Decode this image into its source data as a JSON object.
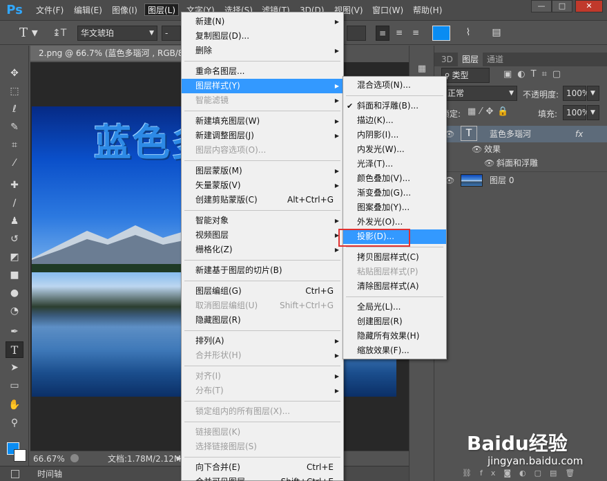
{
  "app": {
    "logo": "Ps"
  },
  "menubar": {
    "items": [
      "文件(F)",
      "编辑(E)",
      "图像(I)",
      "图层(L)",
      "文字(Y)",
      "选择(S)",
      "滤镜(T)",
      "3D(D)",
      "视图(V)",
      "窗口(W)",
      "帮助(H)"
    ]
  },
  "window_controls": {
    "minimize": "—",
    "maximize": "□",
    "close": "✕"
  },
  "options": {
    "font_family": "华文琥珀",
    "font_style": "-",
    "color": "#0a8cf2"
  },
  "document": {
    "tab_title": "2.png @ 66.7% (蓝色多瑙河 , RGB/8) *",
    "title_text": "蓝色多",
    "zoom": "66.67%",
    "doc_info": "文档:1.78M/2.12M",
    "timeline_tab": "时间轴"
  },
  "layers_panel": {
    "tabs": [
      "3D",
      "图层",
      "通道"
    ],
    "filter_kind": "类型",
    "blend_mode": "正常",
    "opacity_label": "不透明度:",
    "opacity_value": "100%",
    "lock_label": "锁定:",
    "fill_label": "填充:",
    "fill_value": "100%",
    "layers": [
      {
        "name": "蓝色多瑙河",
        "type": "text",
        "fx": "fx"
      },
      {
        "name": "效果"
      },
      {
        "name": "斜面和浮雕"
      },
      {
        "name": "图层 0",
        "type": "image"
      }
    ]
  },
  "layer_menu": {
    "items": [
      {
        "label": "新建(N)",
        "submenu": true
      },
      {
        "label": "复制图层(D)..."
      },
      {
        "label": "删除",
        "submenu": true
      },
      {
        "sep": true
      },
      {
        "label": "重命名图层..."
      },
      {
        "label": "图层样式(Y)",
        "submenu": true,
        "highlighted": true
      },
      {
        "label": "智能滤镜",
        "submenu": true,
        "disabled": true
      },
      {
        "sep": true
      },
      {
        "label": "新建填充图层(W)",
        "submenu": true
      },
      {
        "label": "新建调整图层(J)",
        "submenu": true
      },
      {
        "label": "图层内容选项(O)...",
        "disabled": true
      },
      {
        "sep": true
      },
      {
        "label": "图层蒙版(M)",
        "submenu": true
      },
      {
        "label": "矢量蒙版(V)",
        "submenu": true
      },
      {
        "label": "创建剪贴蒙版(C)",
        "shortcut": "Alt+Ctrl+G"
      },
      {
        "sep": true
      },
      {
        "label": "智能对象",
        "submenu": true
      },
      {
        "label": "视频图层",
        "submenu": true
      },
      {
        "label": "栅格化(Z)",
        "submenu": true
      },
      {
        "sep": true
      },
      {
        "label": "新建基于图层的切片(B)"
      },
      {
        "sep": true
      },
      {
        "label": "图层编组(G)",
        "shortcut": "Ctrl+G"
      },
      {
        "label": "取消图层编组(U)",
        "shortcut": "Shift+Ctrl+G",
        "disabled": true
      },
      {
        "label": "隐藏图层(R)"
      },
      {
        "sep": true
      },
      {
        "label": "排列(A)",
        "submenu": true
      },
      {
        "label": "合并形状(H)",
        "submenu": true,
        "disabled": true
      },
      {
        "sep": true
      },
      {
        "label": "对齐(I)",
        "submenu": true,
        "disabled": true
      },
      {
        "label": "分布(T)",
        "submenu": true,
        "disabled": true
      },
      {
        "sep": true
      },
      {
        "label": "锁定组内的所有图层(X)...",
        "disabled": true
      },
      {
        "sep": true
      },
      {
        "label": "链接图层(K)",
        "disabled": true
      },
      {
        "label": "选择链接图层(S)",
        "disabled": true
      },
      {
        "sep": true
      },
      {
        "label": "向下合并(E)",
        "shortcut": "Ctrl+E"
      },
      {
        "label": "合并可见图层",
        "shortcut": "Shift+Ctrl+E"
      }
    ]
  },
  "style_submenu": {
    "items": [
      {
        "label": "混合选项(N)..."
      },
      {
        "sep": true
      },
      {
        "label": "斜面和浮雕(B)...",
        "checked": true
      },
      {
        "label": "描边(K)..."
      },
      {
        "label": "内阴影(I)..."
      },
      {
        "label": "内发光(W)..."
      },
      {
        "label": "光泽(T)..."
      },
      {
        "label": "颜色叠加(V)..."
      },
      {
        "label": "渐变叠加(G)..."
      },
      {
        "label": "图案叠加(Y)..."
      },
      {
        "label": "外发光(O)..."
      },
      {
        "label": "投影(D)...",
        "highlighted": true
      },
      {
        "sep": true
      },
      {
        "label": "拷贝图层样式(C)"
      },
      {
        "label": "粘贴图层样式(P)",
        "disabled": true
      },
      {
        "label": "清除图层样式(A)"
      },
      {
        "sep": true
      },
      {
        "label": "全局光(L)..."
      },
      {
        "label": "创建图层(R)"
      },
      {
        "label": "隐藏所有效果(H)"
      },
      {
        "label": "缩放效果(F)..."
      }
    ]
  },
  "watermark": {
    "logo": "Baidu经验",
    "url": "jingyan.baidu.com"
  }
}
